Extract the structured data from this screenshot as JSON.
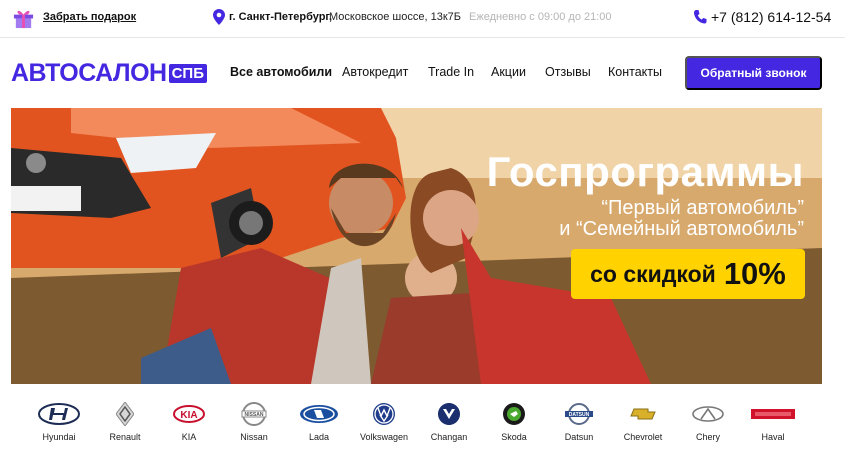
{
  "topbar": {
    "gift_label": "Забрать подарок",
    "city": "г. Санкт-Петербург,",
    "address": "Московское шоссе, 13к7Б",
    "hours": "Ежедневно с 09:00 до 21:00",
    "phone": "+7 (812) 614-12-54"
  },
  "header": {
    "logo_main": "АВТОСАЛОН",
    "logo_tag": "СПБ",
    "nav": [
      "Все автомобили",
      "Автокредит",
      "Trade In",
      "Акции",
      "Отзывы",
      "Контакты"
    ],
    "callback_label": "Обратный звонок"
  },
  "hero": {
    "title": "Госпрограммы",
    "line1": "“Первый автомобиль”",
    "line2": "и “Семейный автомобиль”",
    "badge_text": "со скидкой",
    "badge_value": "10%"
  },
  "brands": [
    {
      "name": "Hyundai",
      "icon": "hyundai-logo-icon"
    },
    {
      "name": "Renault",
      "icon": "renault-logo-icon"
    },
    {
      "name": "KIA",
      "icon": "kia-logo-icon"
    },
    {
      "name": "Nissan",
      "icon": "nissan-logo-icon"
    },
    {
      "name": "Lada",
      "icon": "lada-logo-icon"
    },
    {
      "name": "Volkswagen",
      "icon": "volkswagen-logo-icon"
    },
    {
      "name": "Changan",
      "icon": "changan-logo-icon"
    },
    {
      "name": "Skoda",
      "icon": "skoda-logo-icon"
    },
    {
      "name": "Datsun",
      "icon": "datsun-logo-icon"
    },
    {
      "name": "Chevrolet",
      "icon": "chevrolet-logo-icon"
    },
    {
      "name": "Chery",
      "icon": "chery-logo-icon"
    },
    {
      "name": "Haval",
      "icon": "haval-logo-icon"
    }
  ],
  "colors": {
    "accent": "#4427e0",
    "badge": "#ffd200"
  }
}
